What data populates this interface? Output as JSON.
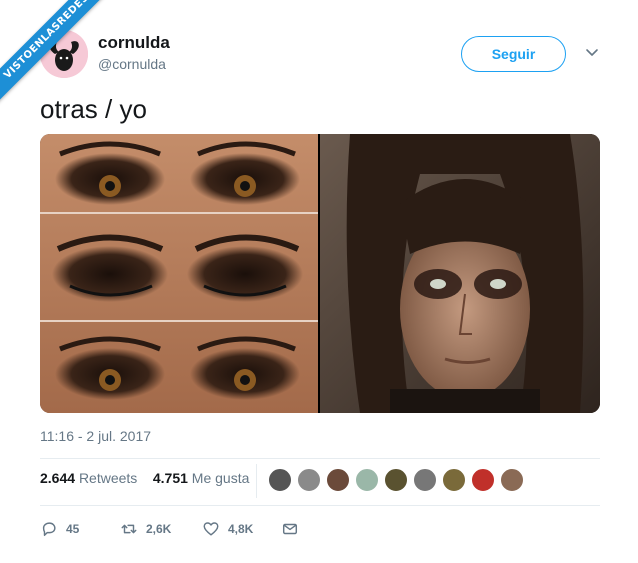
{
  "watermark": {
    "ribbon_text": "VISTOENLASREDES"
  },
  "author": {
    "display_name": "cornulda",
    "handle": "@cornulda"
  },
  "follow_button": {
    "label": "Seguir"
  },
  "tweet": {
    "text": "otras / yo"
  },
  "timestamp": "11:16 - 2 jul. 2017",
  "stats": {
    "retweets_count": "2.644",
    "retweets_label": "Retweets",
    "likes_count": "4.751",
    "likes_label": "Me gusta"
  },
  "actions": {
    "replies": "45",
    "retweets": "2,6K",
    "likes": "4,8K"
  },
  "colors": {
    "accent": "#1da1f2",
    "muted": "#657786",
    "text": "#14171a"
  }
}
